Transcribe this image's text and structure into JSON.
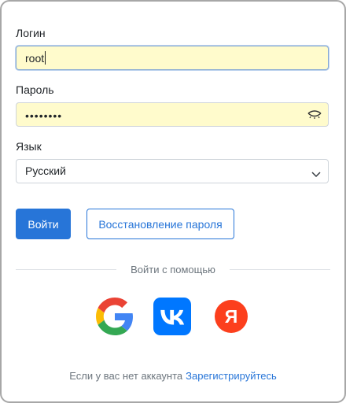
{
  "form": {
    "login_label": "Логин",
    "login_value": "root",
    "password_label": "Пароль",
    "password_masked": "••••••••",
    "language_label": "Язык",
    "language_selected": "Русский"
  },
  "buttons": {
    "login": "Войти",
    "restore_password": "Восстановление пароля"
  },
  "social": {
    "title": "Войти с помощью",
    "providers": [
      "google-icon",
      "vk-icon",
      "yandex-icon"
    ],
    "yandex_letter": "Я",
    "colors": {
      "vk": "#0077ff",
      "yandex": "#fc3f1d"
    }
  },
  "footer": {
    "text": "Если у вас нет аккаунта",
    "register_link": "Зарегистрируйтесь"
  },
  "colors": {
    "accent": "#2775d8",
    "autofill": "#fffbcc"
  }
}
